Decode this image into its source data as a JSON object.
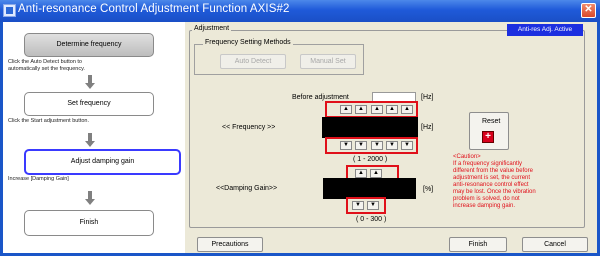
{
  "window": {
    "title": "Anti-resonance Control Adjustment Function AXIS#2",
    "close_glyph": "✕"
  },
  "steps": [
    {
      "label": "Determine frequency",
      "desc": [
        "Click the Auto Detect button to",
        "automatically set the frequency."
      ]
    },
    {
      "label": "Set frequency",
      "desc": [
        "Click the Start adjustment button."
      ]
    },
    {
      "label": "Adjust damping gain",
      "desc": [
        "Increase [Damping Gain]"
      ]
    },
    {
      "label": "Finish",
      "desc": []
    }
  ],
  "adjustment": {
    "group_label": "Adjustment",
    "status_badge": "Anti-res Adj. Active",
    "freq_methods_label": "Frequency Setting Methods",
    "auto_detect_label": "Auto Detect",
    "manual_set_label": "Manual Set",
    "before_adjustment_label": "Before adjustment",
    "hz_unit": "[Hz]",
    "frequency_label": "<< Frequency >>",
    "frequency_value": "",
    "frequency_range": "( 1 - 2000 )",
    "damping_label": "<<Damping Gain>>",
    "damping_value": "",
    "percent_unit": "[%]",
    "damping_range": "( 0 - 300 )",
    "reset_label": "Reset",
    "caution_lines": [
      "<Caution>",
      "If a frequency significantly",
      "different from the value before",
      "adjustment is set, the current",
      "anti-resonance control effect",
      "may be lost. Once the vibration",
      "problem is solved, do not",
      "increase damping gain."
    ],
    "up_glyph": "▲",
    "down_glyph": "▼"
  },
  "footer": {
    "precautions_label": "Precautions",
    "finish_label": "Finish",
    "cancel_label": "Cancel"
  }
}
